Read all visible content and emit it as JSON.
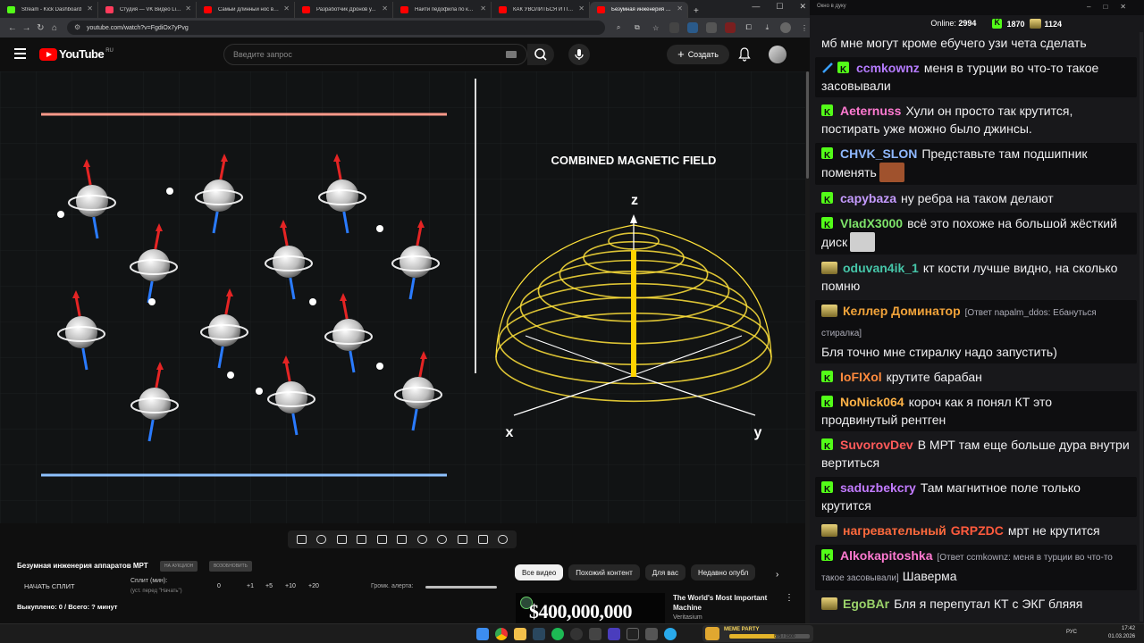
{
  "tabs": [
    {
      "title": "Stream - Kick Dashboard",
      "color": "#53fc18"
    },
    {
      "title": "Студия — VK Видео Live",
      "color": "#ff3b5c"
    },
    {
      "title": "Самый длинный нос в истории",
      "color": "#ff0000"
    },
    {
      "title": "Разработчик Дронов у...",
      "color": "#ff0000"
    },
    {
      "title": "Найти педофила по кирпичу",
      "color": "#ff0000"
    },
    {
      "title": "КАК УВОЛИТЬСЯ И ПОЛУЧ...",
      "color": "#ff0000"
    },
    {
      "title": "Безумная инженерия ап...",
      "color": "#ff0000",
      "active": true
    }
  ],
  "address": {
    "url": "youtube.com/watch?v=FgdiOx7yPvg"
  },
  "youtube": {
    "logo": "YouTube",
    "region": "RU",
    "search_placeholder": "Введите запрос",
    "create_label": "Создать"
  },
  "video": {
    "field_title": "COMBINED MAGNETIC FIELD",
    "axis_z": "z",
    "axis_x": "x",
    "axis_y": "y"
  },
  "below": {
    "title": "Безумная инженерия аппаратов МРТ",
    "btn1": "НА АУКЦИОН",
    "btn2": "ВОЗОБНОВИТЬ",
    "start_split": "НАЧАТЬ СПЛИТ",
    "split_label": "Сплит (мин):",
    "split_hint": "(уст. перед \"Начать\")",
    "split_options": [
      "0",
      "+1",
      "+5",
      "+10",
      "+20"
    ],
    "volume_label": "Громк. алерта:",
    "bought": "Выкуплено: 0 / Всего: ? минут"
  },
  "chips": [
    "Все видео",
    "Похожий контент",
    "Для вас",
    "Недавно опубл"
  ],
  "recommendation": {
    "thumb_text": "$400,000,000",
    "title": "The World's Most Important Machine",
    "channel": "Veritasium"
  },
  "chat": {
    "window_title": "Окно в дуку",
    "online_label": "Online:",
    "online_count": "2994",
    "kick_count": "1870",
    "other_count": "1124",
    "messages": [
      {
        "badge": "",
        "user": "",
        "color": "#fff",
        "reply": "",
        "text": "мб мне могут кроме ебучего узи чета сделать"
      },
      {
        "badge": "kick2",
        "user": "ccmkownz",
        "color": "#b57bff",
        "reply": "",
        "text": "меня в турции во что-то такое засовывали"
      },
      {
        "badge": "kick",
        "user": "Aeternuss",
        "color": "#ff7ad1",
        "reply": "",
        "text": "Хули он просто так крутится, постирать уже можно было джинсы."
      },
      {
        "badge": "kick",
        "user": "CHVK_SLON",
        "color": "#8fb8ff",
        "reply": "",
        "text": "Представьте там подшипник поменять",
        "emote": "#a0522d"
      },
      {
        "badge": "kick",
        "user": "capybaza",
        "color": "#c59bff",
        "reply": "",
        "text": "ну ребра на таком делают"
      },
      {
        "badge": "kick",
        "user": "VladX3000",
        "color": "#7ee36a",
        "reply": "",
        "text": "всё это похоже на большой жёсткий диск",
        "emote": "#cfcfcf"
      },
      {
        "badge": "gold",
        "user": "oduvan4ik_1",
        "color": "#46c6a9",
        "reply": "",
        "text": "кт кости лучше видно, на сколько помню"
      },
      {
        "badge": "gold",
        "user": "Келлер Доминатор",
        "color": "#f1a33a",
        "reply": "[Ответ napalm_ddos: Ебануться стиралка]",
        "text": "Бля точно мне стиралку надо запустить)"
      },
      {
        "badge": "kick",
        "user": "IoFIXol",
        "color": "#ff8a3d",
        "reply": "",
        "text": "крутите барабан"
      },
      {
        "badge": "kick",
        "user": "NoNick064",
        "color": "#ffb347",
        "reply": "",
        "text": "короч как я понял КТ это продвинутый рентген"
      },
      {
        "badge": "kick",
        "user": "SuvorovDev",
        "color": "#ff5a5a",
        "reply": "",
        "text": "В МРТ там еще больше дура внутри вертиться"
      },
      {
        "badge": "kick",
        "user": "saduzbekcry",
        "color": "#c27bff",
        "reply": "",
        "text": "Там магнитное поле только крутится"
      },
      {
        "badge": "gold",
        "user": "нагревательный",
        "color": "#ff6a3d",
        "user2": "GRPZDC",
        "reply": "",
        "text": "мрт не крутится"
      },
      {
        "badge": "kick",
        "user": "Alkokapitoshka",
        "color": "#ff7ad1",
        "reply": "[Ответ ccmkownz: меня в турции во что-то такое засовывали]",
        "text": "Шаверма"
      },
      {
        "badge": "gold",
        "user": "EgoBAr",
        "color": "#9bd36a",
        "reply": "",
        "text": "Бля я перепутал КТ с ЭКГ бляяя"
      }
    ]
  },
  "taskbar": {
    "widget_label": "MEME PARTY",
    "widget_count": "875 / 1500",
    "widget_progress": 0.58,
    "lang": "РУС",
    "time": "17:42",
    "date": "01.03.2026"
  }
}
